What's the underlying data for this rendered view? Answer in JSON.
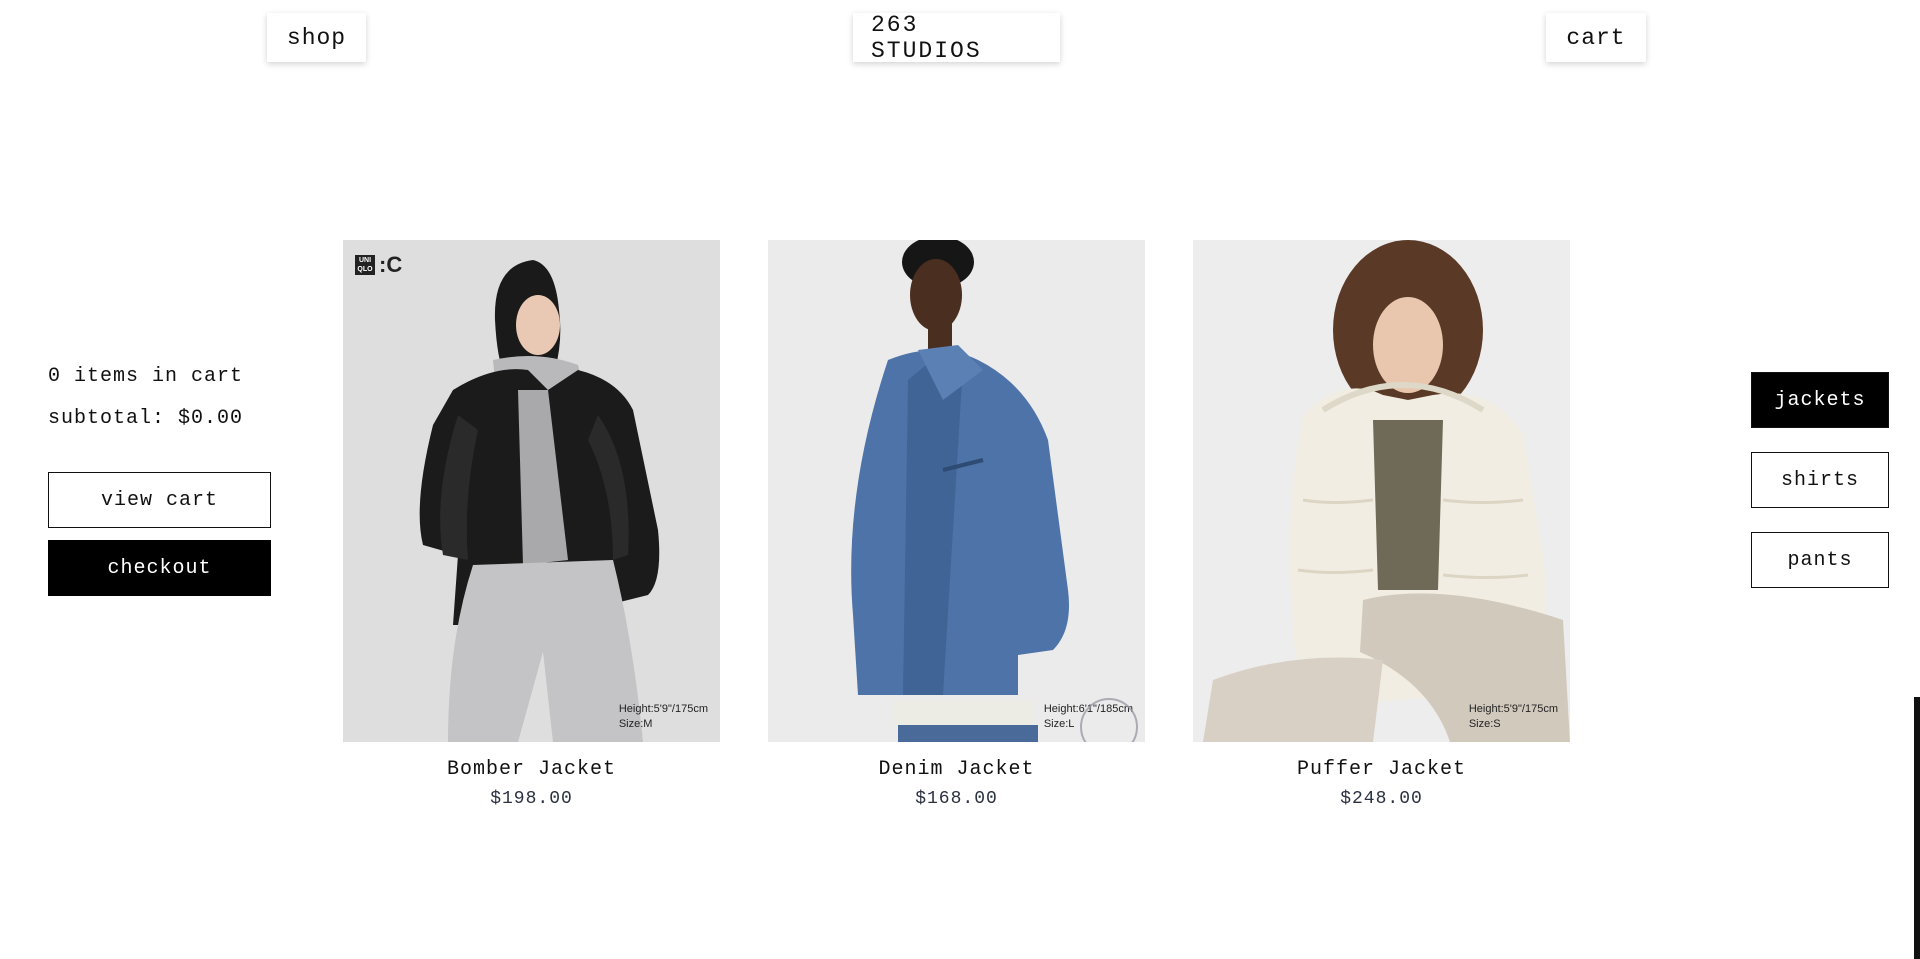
{
  "header": {
    "shop_label": "shop",
    "brand_label": "263 STUDIOS",
    "cart_label": "cart"
  },
  "cart_summary": {
    "items_text": "0 items in cart",
    "subtotal_text": "subtotal: $0.00",
    "view_cart_label": "view cart",
    "checkout_label": "checkout"
  },
  "categories": [
    {
      "label": "jackets",
      "active": true
    },
    {
      "label": "shirts",
      "active": false
    },
    {
      "label": "pants",
      "active": false
    }
  ],
  "products": [
    {
      "name": "Bomber Jacket",
      "price": "$198.00",
      "caption_height": "Height:5'9\"/175cm",
      "caption_size": "Size:M",
      "logo_box": "UNI QLO",
      "logo_mark": ":C"
    },
    {
      "name": "Denim Jacket",
      "price": "$168.00",
      "caption_height": "Height:6'1\"/185cm",
      "caption_size": "Size:L"
    },
    {
      "name": "Puffer Jacket",
      "price": "$248.00",
      "caption_height": "Height:5'9\"/175cm",
      "caption_size": "Size:S"
    }
  ],
  "colors": {
    "accent_black": "#000000",
    "background": "#ffffff",
    "price_text": "#2a3140",
    "bomber_bg": "#dedede",
    "denim_bg": "#ebebec",
    "puffer_bg": "#ededee"
  }
}
